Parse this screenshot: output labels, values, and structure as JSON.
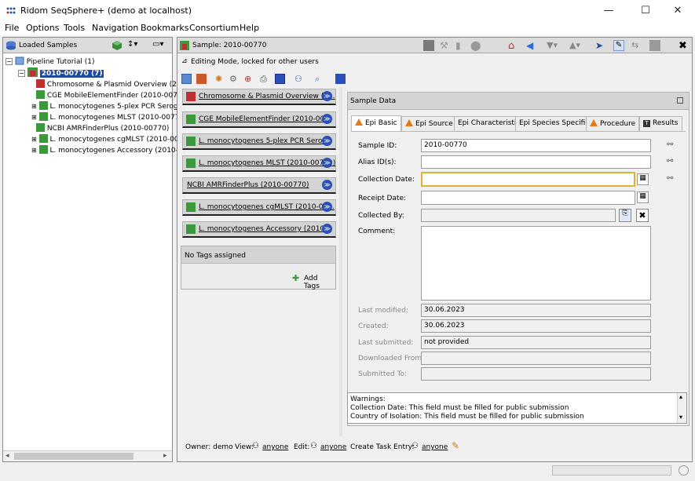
{
  "window": {
    "title": "Ridom SeqSphere+ (demo at localhost)"
  },
  "menu": [
    "File",
    "Options",
    "Tools",
    "Navigation",
    "Bookmarks",
    "Consortium",
    "Help"
  ],
  "left": {
    "header": "Loaded Samples",
    "tree": {
      "root": "Pipeline Tutorial (1)",
      "sample": "2010-00770 (7)",
      "children": [
        "Chromosome & Plasmid Overview (2",
        "CGE MobileElementFinder (2010-007",
        "L. monocytogenes 5-plex PCR Serogr",
        "L. monocytogenes MLST (2010-00770",
        "NCBI AMRFinderPlus (2010-00770)",
        "L. monocytogenes cgMLST (2010-007",
        "L. monocytogenes Accessory (2010-0"
      ]
    }
  },
  "right": {
    "header": "Sample: 2010-00770",
    "editing_mode": "Editing Mode, locked for other users",
    "modules": [
      "Chromosome & Plasmid Overview (2...",
      "CGE MobileElementFinder (2010-00...",
      "L. monocytogenes 5-plex PCR Sero...",
      "L. monocytogenes MLST (2010-00770)",
      "NCBI AMRFinderPlus (2010-00770)",
      "L. monocytogenes cgMLST (2010-00...",
      "L. monocytogenes Accessory (2010..."
    ],
    "tags": {
      "title": "No Tags assigned",
      "add": "Add Tags"
    },
    "sample_data": {
      "title": "Sample Data",
      "tabs": [
        "Epi Basic",
        "Epi Source",
        "Epi Characteristic",
        "Epi Species Specific",
        "Procedure",
        "Results"
      ],
      "fields": {
        "sample_id": {
          "label": "Sample ID:",
          "value": "2010-00770"
        },
        "alias": {
          "label": "Alias ID(s):",
          "value": ""
        },
        "collection_date": {
          "label": "Collection Date:",
          "value": ""
        },
        "receipt_date": {
          "label": "Receipt Date:",
          "value": ""
        },
        "collected_by": {
          "label": "Collected By:",
          "value": ""
        },
        "comment": {
          "label": "Comment:",
          "value": ""
        },
        "last_modified": {
          "label": "Last modified:",
          "value": "30.06.2023"
        },
        "created": {
          "label": "Created:",
          "value": "30.06.2023"
        },
        "last_submitted": {
          "label": "Last submitted:",
          "value": "not provided"
        },
        "downloaded_from": {
          "label": "Downloaded From:",
          "value": ""
        },
        "submitted_to": {
          "label": "Submitted To:",
          "value": ""
        }
      },
      "warnings": {
        "title": "Warnings:",
        "lines": [
          "Collection Date:  This field must be filled for public submission",
          "Country of Isolation:  This field must be filled for public submission"
        ]
      }
    },
    "footer": {
      "owner": "Owner: demo",
      "view_label": "View:",
      "view_value": "anyone",
      "edit_label": "Edit:",
      "edit_value": "anyone",
      "task_label": "Create Task Entry:",
      "task_value": "anyone"
    }
  }
}
